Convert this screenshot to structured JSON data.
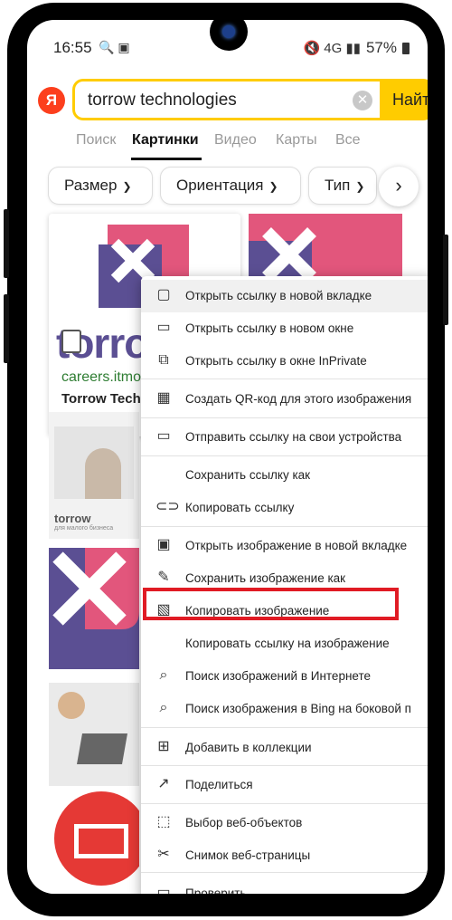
{
  "status": {
    "time": "16:55",
    "icons": "🔍 ▣",
    "signal": "🔇 4G ▮▮ ",
    "battery": "57%"
  },
  "search": {
    "logo": "Я",
    "query": "torrow technologies",
    "clear": "✕",
    "find_label": "Найти"
  },
  "tabs": [
    {
      "label": "Поиск"
    },
    {
      "label": "Картинки"
    },
    {
      "label": "Видео"
    },
    {
      "label": "Карты"
    },
    {
      "label": "Все"
    }
  ],
  "filters": [
    {
      "label": "Размер"
    },
    {
      "label": "Ориентация"
    },
    {
      "label": "Тип"
    }
  ],
  "filters_next": "›",
  "results": {
    "first": {
      "logo_text": "torro",
      "domain": "careers.itmo",
      "title": "Torrow Tech"
    },
    "third": {
      "logo_text": "torrow",
      "caption": "для малого бизнеса"
    }
  },
  "context_menu": [
    {
      "label": "Открыть ссылку в новой вкладке",
      "icon": "new-tab-icon"
    },
    {
      "label": "Открыть ссылку в новом окне",
      "icon": "new-window-icon"
    },
    {
      "label": "Открыть ссылку в окне InPrivate",
      "icon": "inprivate-icon"
    },
    {
      "label": "Создать QR-код для этого изображения",
      "icon": "qr-code-icon"
    },
    {
      "label": "Отправить ссылку на свои устройства",
      "icon": "devices-icon"
    },
    {
      "label": "Сохранить ссылку как",
      "icon": ""
    },
    {
      "label": "Копировать ссылку",
      "icon": "link-icon"
    },
    {
      "label": "Открыть изображение в новой вкладке",
      "icon": "image-tab-icon"
    },
    {
      "label": "Сохранить изображение как",
      "icon": "save-image-icon"
    },
    {
      "label": "Копировать изображение",
      "icon": "copy-image-icon"
    },
    {
      "label": "Копировать ссылку на изображение",
      "icon": ""
    },
    {
      "label": "Поиск изображений в Интернете",
      "icon": "image-search-icon"
    },
    {
      "label": "Поиск изображения в Bing на боковой п",
      "icon": "bing-sidebar-icon"
    },
    {
      "label": "Добавить в коллекции",
      "icon": "collections-icon"
    },
    {
      "label": "Поделиться",
      "icon": "share-icon"
    },
    {
      "label": "Выбор веб-объектов",
      "icon": "web-select-icon"
    },
    {
      "label": "Снимок веб-страницы",
      "icon": "screenshot-icon"
    },
    {
      "label": "Проверить",
      "icon": "inspect-icon"
    }
  ],
  "colors": {
    "accent": "#ffcc00",
    "highlight": "#e01b24",
    "brand_pink": "#e2567c",
    "brand_purple": "#5b4f93"
  }
}
